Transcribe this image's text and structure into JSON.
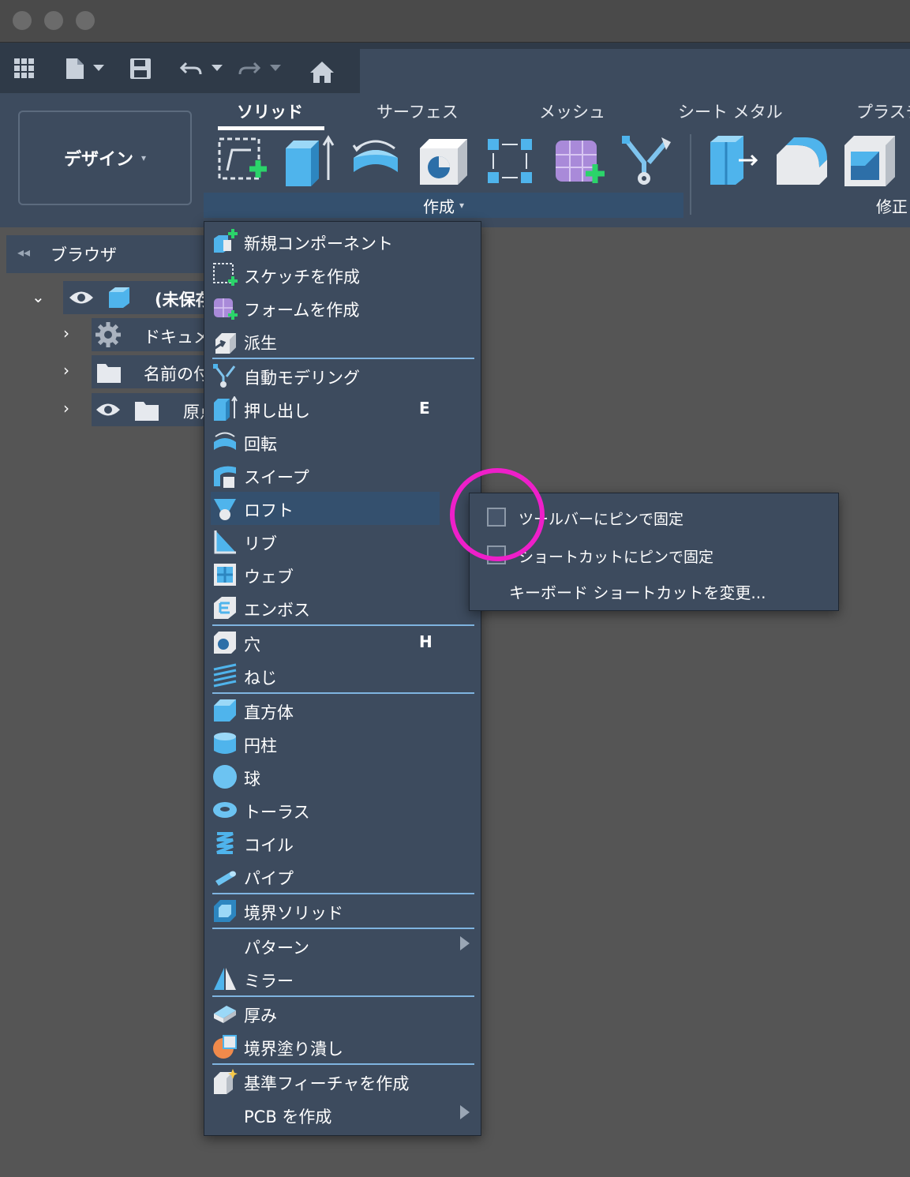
{
  "window": {
    "traffic_lights": [
      "close",
      "minimize",
      "maximize"
    ]
  },
  "ribbon": {
    "workspace": {
      "label": "デザイン",
      "caret": "▾"
    },
    "tabs": [
      {
        "label": "ソリッド",
        "active": true
      },
      {
        "label": "サーフェス"
      },
      {
        "label": "メッシュ"
      },
      {
        "label": "シート メタル"
      },
      {
        "label": "プラスチ"
      }
    ],
    "groups": {
      "create": {
        "label": "作成",
        "caret": "▾"
      },
      "modify": {
        "label": "修正"
      }
    }
  },
  "browser": {
    "collapse_glyph": "◂◂",
    "title": "ブラウザ",
    "tree": [
      {
        "label": "(未保存"
      },
      {
        "label": "ドキュメ"
      },
      {
        "label": "名前の付"
      },
      {
        "label": "原点"
      }
    ]
  },
  "create_menu": {
    "items": [
      {
        "label": "新規コンポーネント",
        "icon": "new-component-icon"
      },
      {
        "label": "スケッチを作成",
        "icon": "create-sketch-icon"
      },
      {
        "label": "フォームを作成",
        "icon": "create-form-icon"
      },
      {
        "label": "派生",
        "icon": "derive-icon"
      },
      {
        "label": "自動モデリング",
        "icon": "automodel-icon"
      },
      {
        "label": "押し出し",
        "icon": "extrude-icon",
        "shortcut": "E"
      },
      {
        "label": "回転",
        "icon": "revolve-icon"
      },
      {
        "label": "スイープ",
        "icon": "sweep-icon"
      },
      {
        "label": "ロフト",
        "icon": "loft-icon",
        "highlighted": true
      },
      {
        "label": "リブ",
        "icon": "rib-icon"
      },
      {
        "label": "ウェブ",
        "icon": "web-icon"
      },
      {
        "label": "エンボス",
        "icon": "emboss-icon"
      },
      {
        "label": "穴",
        "icon": "hole-icon",
        "shortcut": "H"
      },
      {
        "label": "ねじ",
        "icon": "thread-icon"
      },
      {
        "label": "直方体",
        "icon": "box-icon"
      },
      {
        "label": "円柱",
        "icon": "cylinder-icon"
      },
      {
        "label": "球",
        "icon": "sphere-icon"
      },
      {
        "label": "トーラス",
        "icon": "torus-icon"
      },
      {
        "label": "コイル",
        "icon": "coil-icon"
      },
      {
        "label": "パイプ",
        "icon": "pipe-icon"
      },
      {
        "label": "境界ソリッド",
        "icon": "boundary-solid-icon"
      },
      {
        "label": "パターン",
        "icon": "",
        "submenu": true
      },
      {
        "label": "ミラー",
        "icon": "mirror-icon"
      },
      {
        "label": "厚み",
        "icon": "thicken-icon"
      },
      {
        "label": "境界塗り潰し",
        "icon": "boundary-fill-icon"
      },
      {
        "label": "基準フィーチャを作成",
        "icon": "base-feature-icon"
      },
      {
        "label": "PCB を作成",
        "icon": "",
        "submenu": true
      }
    ]
  },
  "context_menu": {
    "items": [
      {
        "label": "ツールバーにピンで固定",
        "checkbox": true,
        "checked": false
      },
      {
        "label": "ショートカットにピンで固定",
        "checkbox": true,
        "checked": false
      },
      {
        "label": "キーボード ショートカットを変更...",
        "checkbox": false
      }
    ]
  },
  "colors": {
    "ribbon_bg": "#3d4b5e",
    "highlight": "#34506e",
    "separator": "#7fb4e0",
    "annotation": "#ee1fc9",
    "accent_blue": "#4fb4ec",
    "accent_green": "#2bd46a"
  }
}
